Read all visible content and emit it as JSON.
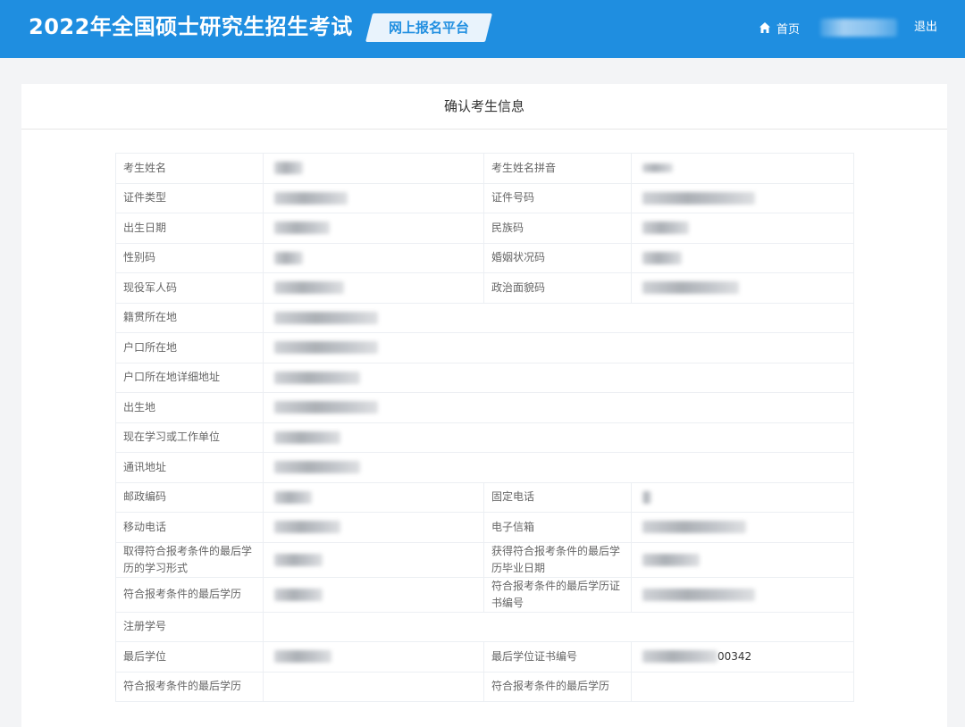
{
  "header": {
    "app_title": "2022年全国硕士研究生招生考试",
    "platform_label": "网上报名平台",
    "home_label": "首页",
    "logout_label": "退出",
    "home_icon": "home-icon",
    "brand_color": "#1f8ee0"
  },
  "card": {
    "title": "确认考生信息"
  },
  "fields": {
    "name": "考生姓名",
    "name_pinyin": "考生姓名拼音",
    "id_type": "证件类型",
    "id_number": "证件号码",
    "birth_date": "出生日期",
    "ethnicity_code": "民族码",
    "gender_code": "性别码",
    "marital_status_code": "婚姻状况码",
    "active_military_code": "现役军人码",
    "political_status_code": "政治面貌码",
    "native_place": "籍贯所在地",
    "household_location": "户口所在地",
    "household_address_detail": "户口所在地详细地址",
    "birthplace": "出生地",
    "current_unit": "现在学习或工作单位",
    "mailing_address": "通讯地址",
    "postal_code": "邮政编码",
    "landline": "固定电话",
    "mobile": "移动电话",
    "email": "电子信箱",
    "last_study_form": "取得符合报考条件的最后学历的学习形式",
    "last_grad_date": "获得符合报考条件的最后学历毕业日期",
    "last_education": "符合报考条件的最后学历",
    "last_cert_number": "符合报考条件的最后学历证书编号",
    "registration_number": "注册学号",
    "last_degree": "最后学位",
    "last_degree_cert_number": "最后学位证书编号",
    "cut_left": "符合报考条件的最后学历",
    "cut_right": "符合报考条件的最后学历"
  },
  "values": {
    "last_degree_cert_suffix": "00342"
  }
}
